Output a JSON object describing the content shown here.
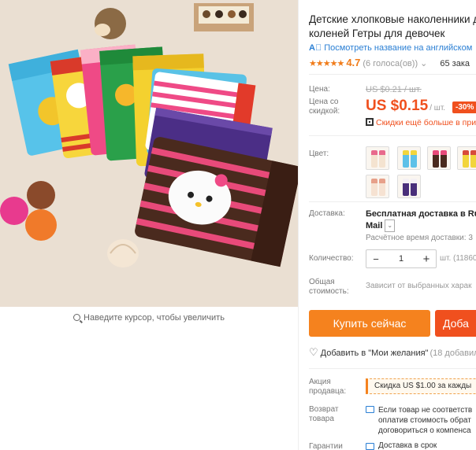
{
  "product": {
    "title_line1": "Детские хлопковые наколенники д",
    "title_line2": "коленей Гетры для девочек",
    "translate_link": "Посмотреть название на английском",
    "rating_value": "4.7",
    "votes": "(6 голоса(ов))",
    "orders": "65 зака"
  },
  "price": {
    "price_label": "Цена:",
    "old_price": "US $0.21 / шт.",
    "discount_label": "Цена со скидкой:",
    "current_price": "US $0.15",
    "per_unit": "/ шт.",
    "discount_badge": "-30%",
    "qr_discount": "Скидки ещё больше в при"
  },
  "color": {
    "label": "Цвет:",
    "swatches": [
      {
        "name": "white-pink",
        "c1": "#f4e3d0",
        "c2": "#e86a8c"
      },
      {
        "name": "blue",
        "c1": "#5ec1e8",
        "c2": "#f2d53c"
      },
      {
        "name": "brown",
        "c1": "#4a2a1e",
        "c2": "#e84a7a"
      },
      {
        "name": "yellow",
        "c1": "#f2d53c",
        "c2": "#d84a3a"
      },
      {
        "name": "white-pink-2",
        "c1": "#f6e2d2",
        "c2": "#e7a08a"
      },
      {
        "name": "purple",
        "c1": "#4a2f7a",
        "c2": "#f4f0f4"
      }
    ]
  },
  "shipping": {
    "label": "Доставка:",
    "title_line1": "Бесплатная доставка в Rus",
    "title_line2": "Mail",
    "time": "Расчётное время доставки: 3"
  },
  "quantity": {
    "label": "Количество:",
    "minus": "−",
    "value": "1",
    "plus": "+",
    "stock": "шт. (11860"
  },
  "total": {
    "label_line1": "Общая",
    "label_line2": "стоимость:",
    "value": "Зависит от выбранных харак"
  },
  "actions": {
    "buy_now": "Купить сейчас",
    "add_to_cart": "Доба",
    "wishlist": "Добавить в \"Мои желания\"",
    "wishlist_count": "(18 добавил"
  },
  "seller_promo": {
    "label_line1": "Акция",
    "label_line2": "продавца:",
    "text": "Скидка US $1.00 за кажды"
  },
  "returns": {
    "label_line1": "Возврат",
    "label_line2": "товара",
    "line1": "Если товар не соответств",
    "line2": "оплатив стоимость обрат",
    "line3": "договориться о компенса"
  },
  "guarantee": {
    "label": "Гарантии",
    "text": "Доставка в срок"
  },
  "image": {
    "zoom_hint": "Наведите курсор, чтобы увеличить"
  }
}
